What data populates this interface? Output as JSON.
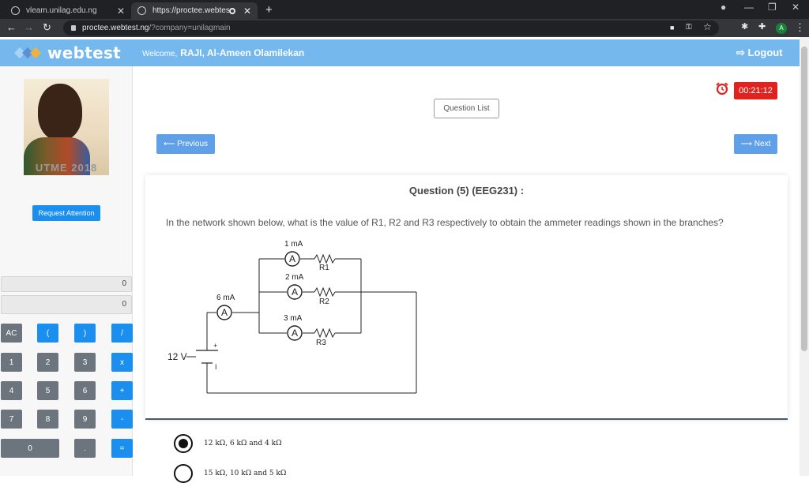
{
  "browser": {
    "tabs": [
      {
        "title": "vleam.unilag.edu.ng"
      },
      {
        "title": "https://proctee.webtest.ng/"
      }
    ],
    "url_host": "proctee.webtest.ng",
    "url_path": "/?company=unilagmain",
    "profile_initial": "A"
  },
  "header": {
    "brand": "webtest",
    "welcome_label": "Welcome,",
    "user_name": "RAJI, Al-Ameen Olamilekan",
    "logout_label": "Logout",
    "color": "#74b8ee"
  },
  "sidebar": {
    "photo_stamp": "UTME 2018",
    "request_attention_label": "Request Attention",
    "calculator": {
      "display_top": "0",
      "display_bottom": "0",
      "keys": [
        [
          "AC",
          "(",
          ")",
          "/"
        ],
        [
          "1",
          "2",
          "3",
          "x"
        ],
        [
          "4",
          "5",
          "6",
          "+"
        ],
        [
          "7",
          "8",
          "9",
          "-"
        ],
        [
          "0",
          ".",
          "="
        ]
      ]
    }
  },
  "timer": {
    "value": "00:21:12",
    "color": "#e0231f"
  },
  "question_list_label": "Question List",
  "nav": {
    "previous_label": "Previous",
    "next_label": "Next"
  },
  "question": {
    "title": "Question (5) (EEG231) :",
    "text": "In the network shown below, what is the value of R1, R2 and R3 respectively to obtain the ammeter readings shown in the branches?",
    "circuit": {
      "source": "12 V",
      "main_meter": "6 mA",
      "branches": [
        {
          "current": "1 mA",
          "resistor": "R1"
        },
        {
          "current": "2 mA",
          "resistor": "R2"
        },
        {
          "current": "3 mA",
          "resistor": "R3"
        }
      ],
      "ammeter_symbol": "A",
      "plus_sign": "+",
      "minus_sign": "I"
    }
  },
  "options": [
    {
      "text": "12 kΩ, 6 kΩ and 4 kΩ",
      "selected": true
    },
    {
      "text": "15 kΩ, 10 kΩ and 5 kΩ",
      "selected": false
    }
  ]
}
